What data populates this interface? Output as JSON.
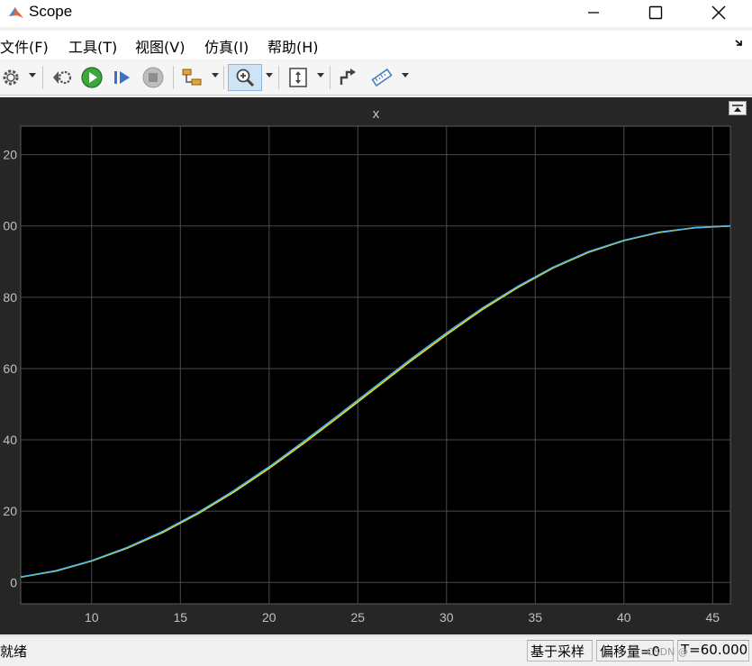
{
  "window": {
    "title": "Scope",
    "controls": [
      "minimize",
      "maximize",
      "close"
    ]
  },
  "menu": {
    "items": [
      "文件(F)",
      "工具(T)",
      "视图(V)",
      "仿真(I)",
      "帮助(H)"
    ]
  },
  "toolbar": {
    "buttons": [
      "settings",
      "step-back",
      "run",
      "step-forward",
      "stop",
      "highlight-block",
      "zoom-in",
      "autoscale",
      "write-data",
      "measurements"
    ]
  },
  "plot": {
    "title": "x"
  },
  "chart_data": {
    "type": "line",
    "title": "x",
    "xlabel": "",
    "ylabel": "",
    "xlim": [
      6,
      46
    ],
    "ylim": [
      -6,
      128
    ],
    "xticks": [
      10,
      15,
      20,
      25,
      30,
      35,
      40,
      45
    ],
    "xtick_labels": [
      "10",
      "15",
      "20",
      "25",
      "30",
      "35",
      "40",
      "45"
    ],
    "yticks": [
      0,
      20,
      40,
      60,
      80,
      100,
      120
    ],
    "ytick_labels": [
      "0",
      "20",
      "40",
      "60",
      "80",
      "00",
      "20"
    ],
    "grid": true,
    "series": [
      {
        "color": "#f0e000",
        "x": [
          6,
          8,
          10,
          12,
          14,
          16,
          18,
          20,
          22,
          24,
          26,
          28,
          30,
          32,
          34,
          36,
          38,
          40,
          42,
          44,
          46
        ],
        "y": [
          1.5,
          3.2,
          6.0,
          9.6,
          14.0,
          19.3,
          25.3,
          32.0,
          39.2,
          46.8,
          54.5,
          62.2,
          69.5,
          76.5,
          82.7,
          88.2,
          92.6,
          95.9,
          98.2,
          99.5,
          100.0
        ]
      },
      {
        "color": "#4fb8f0",
        "x": [
          6,
          8,
          10,
          12,
          14,
          16,
          18,
          20,
          22,
          24,
          26,
          28,
          30,
          32,
          34,
          36,
          38,
          40,
          42,
          44,
          46
        ],
        "y": [
          1.5,
          3.3,
          6.1,
          9.8,
          14.3,
          19.6,
          25.7,
          32.4,
          39.7,
          47.3,
          55.0,
          62.7,
          70.0,
          76.9,
          83.0,
          88.4,
          92.8,
          96.0,
          98.3,
          99.5,
          100.0
        ]
      }
    ]
  },
  "status": {
    "ready": "就绪",
    "sample_based": "基于采样",
    "offset": "偏移量=0",
    "time": "T=60.000",
    "watermark": "CSDN @"
  }
}
